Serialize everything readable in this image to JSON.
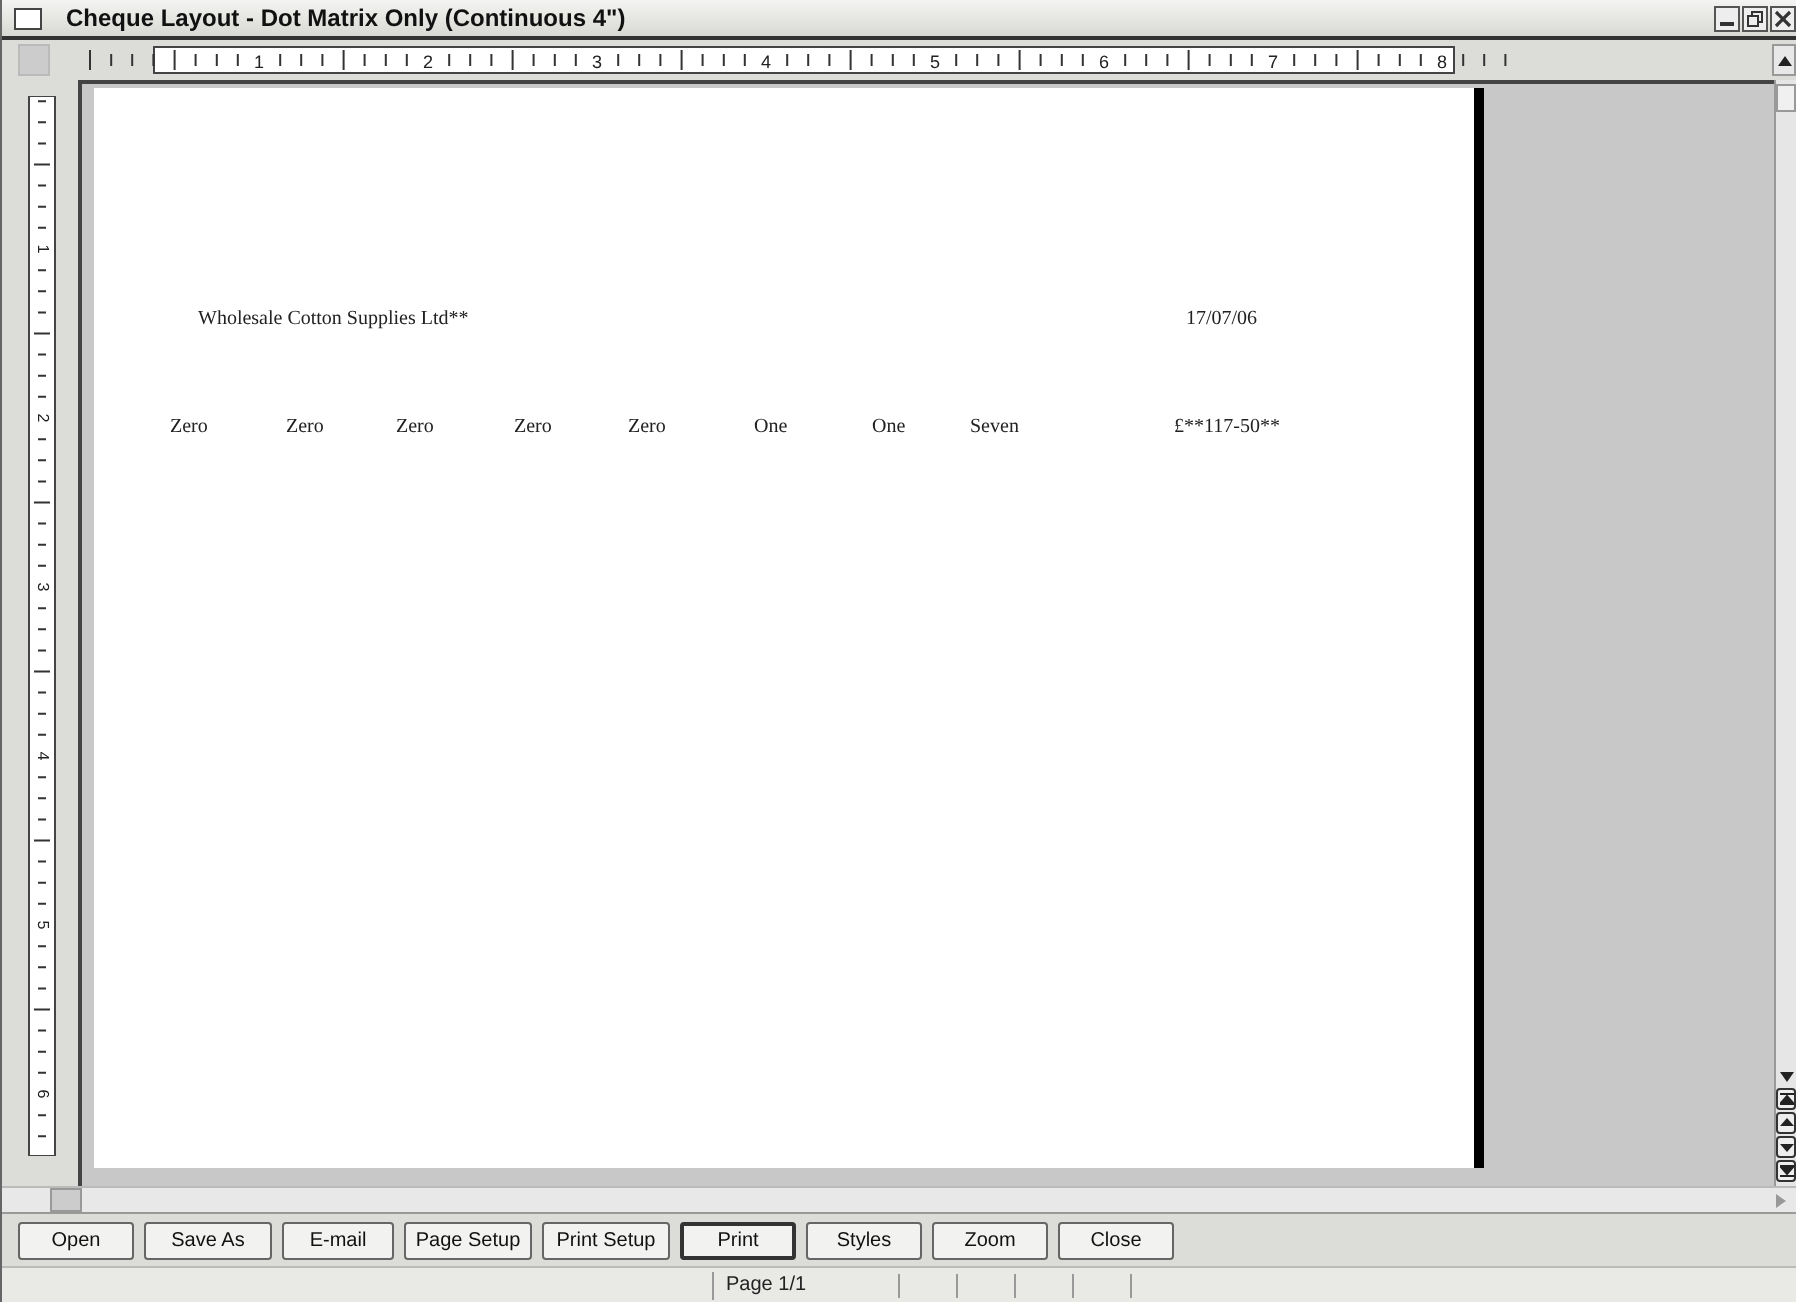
{
  "window": {
    "title": "Cheque Layout - Dot Matrix Only (Continuous 4\")"
  },
  "ruler": {
    "horizontal_numbers": [
      "1",
      "2",
      "3",
      "4",
      "5",
      "6",
      "7",
      "8"
    ],
    "vertical_numbers": [
      "1",
      "2",
      "3",
      "4",
      "5",
      "6"
    ]
  },
  "cheque": {
    "payee": "Wholesale Cotton Supplies Ltd**",
    "date": "17/07/06",
    "amount_words": [
      "Zero",
      "Zero",
      "Zero",
      "Zero",
      "Zero",
      "One",
      "One",
      "Seven"
    ],
    "amount": "£**117-50**"
  },
  "buttons": [
    {
      "label": "Open",
      "default": false
    },
    {
      "label": "Save As",
      "default": false
    },
    {
      "label": "E-mail",
      "default": false
    },
    {
      "label": "Page Setup",
      "default": false
    },
    {
      "label": "Print Setup",
      "default": false
    },
    {
      "label": "Print",
      "default": true
    },
    {
      "label": "Styles",
      "default": false
    },
    {
      "label": "Zoom",
      "default": false
    },
    {
      "label": "Close",
      "default": false
    }
  ],
  "status_bar": {
    "page": "Page 1/1"
  }
}
